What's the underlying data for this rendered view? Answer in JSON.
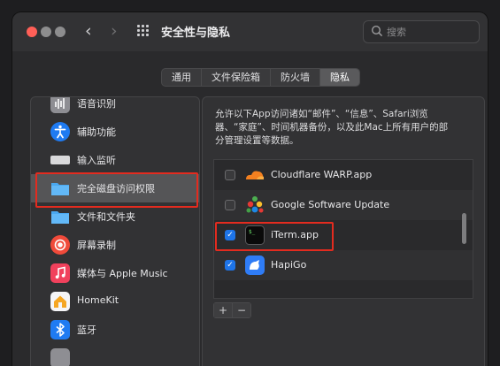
{
  "window": {
    "title": "安全性与隐私",
    "search_placeholder": "搜索"
  },
  "tabs": [
    {
      "label": "通用",
      "active": false
    },
    {
      "label": "文件保险箱",
      "active": false
    },
    {
      "label": "防火墙",
      "active": false
    },
    {
      "label": "隐私",
      "active": true
    }
  ],
  "sidebar": {
    "items": [
      {
        "label": "语音识别",
        "icon": "speech-recognition-icon"
      },
      {
        "label": "辅助功能",
        "icon": "accessibility-icon"
      },
      {
        "label": "输入监听",
        "icon": "keyboard-icon"
      },
      {
        "label": "完全磁盘访问权限",
        "icon": "folder-icon",
        "selected": true
      },
      {
        "label": "文件和文件夹",
        "icon": "folder-icon"
      },
      {
        "label": "屏幕录制",
        "icon": "screen-recording-icon"
      },
      {
        "label": "媒体与 Apple Music",
        "icon": "music-icon"
      },
      {
        "label": "HomeKit",
        "icon": "home-icon"
      },
      {
        "label": "蓝牙",
        "icon": "bluetooth-icon"
      }
    ]
  },
  "detail": {
    "description": "允许以下App访问诸如“邮件”、“信息”、Safari浏览器、“家庭”、时间机器备份，以及此Mac上所有用户的部分管理设置等数据。",
    "apps": [
      {
        "label": "Cloudflare WARP.app",
        "checked": false,
        "icon": "cloudflare-icon"
      },
      {
        "label": "Google Software Update",
        "checked": false,
        "icon": "google-update-icon"
      },
      {
        "label": "iTerm.app",
        "checked": true,
        "icon": "terminal-icon"
      },
      {
        "label": "HapiGo",
        "checked": true,
        "icon": "hapigo-icon"
      }
    ],
    "add_label": "+",
    "remove_label": "−"
  },
  "colors": {
    "highlight": "#e32b1f",
    "accent": "#1e74e8"
  }
}
